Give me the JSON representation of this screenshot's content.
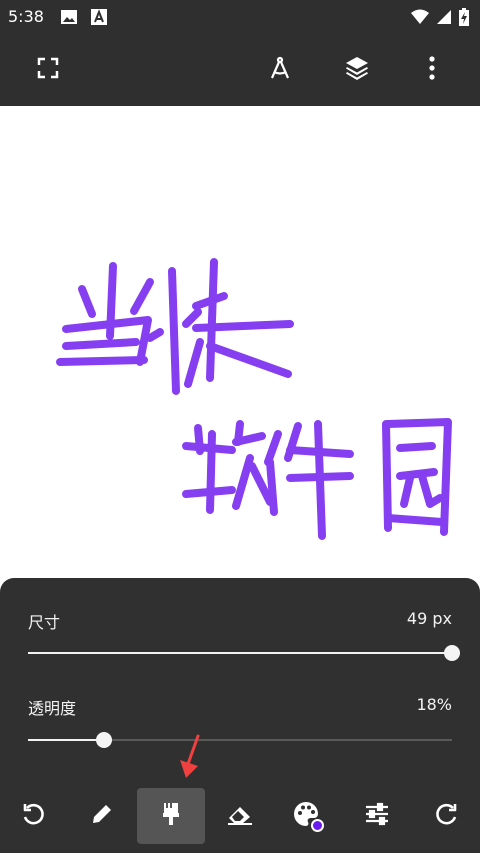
{
  "status_bar": {
    "time": "5:38",
    "icons": [
      "image-icon",
      "app-notification-icon",
      "wifi-icon",
      "signal-icon",
      "battery-charging-icon"
    ]
  },
  "toolbar": {
    "icons": [
      "fullscreen-icon",
      "compass-icon",
      "layers-icon",
      "more-vert-icon"
    ]
  },
  "canvas": {
    "stroke_color": "#7b2ff0",
    "drawn_text": "当快软件园"
  },
  "brush_panel": {
    "size": {
      "label": "尺寸",
      "value": "49 px",
      "fraction": 1.0
    },
    "opacity": {
      "label": "透明度",
      "value": "18%",
      "fraction": 0.18
    }
  },
  "bottom_bar": {
    "tools": [
      "undo-icon",
      "pencil-icon",
      "brush-icon",
      "eraser-icon",
      "palette-icon",
      "adjust-icon",
      "redo-icon"
    ],
    "selected_tool": "brush-icon",
    "current_color": "#6a1bf0"
  },
  "colors": {
    "bar_background": "#2f2f2f",
    "panel_background": "#303030",
    "accent_arrow": "#f04040"
  }
}
